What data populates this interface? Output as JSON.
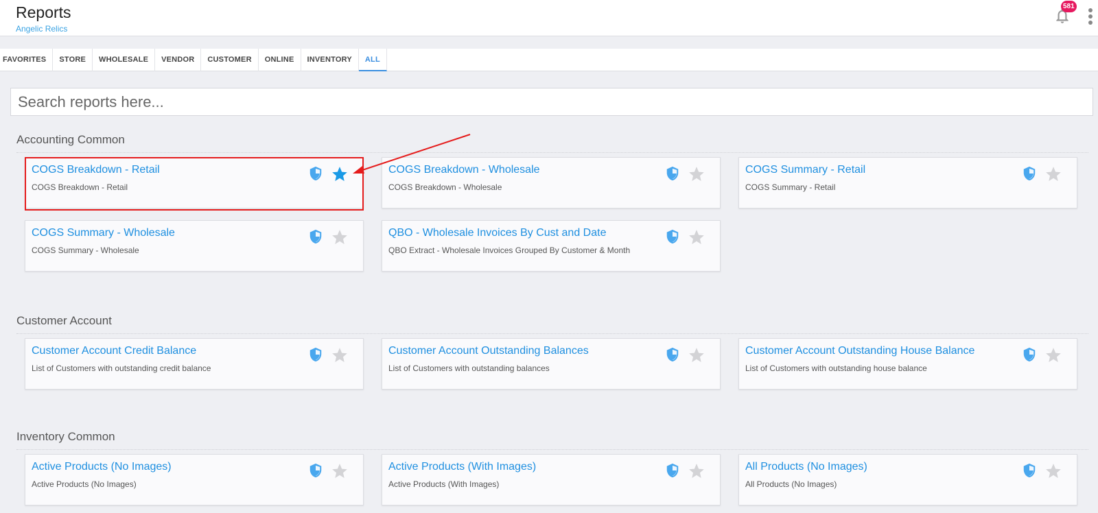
{
  "header": {
    "title": "Reports",
    "subtitle": "Angelic Relics",
    "notification_count": "581"
  },
  "tabs": [
    {
      "label": "FAVORITES",
      "active": false
    },
    {
      "label": "STORE",
      "active": false
    },
    {
      "label": "WHOLESALE",
      "active": false
    },
    {
      "label": "VENDOR",
      "active": false
    },
    {
      "label": "CUSTOMER",
      "active": false
    },
    {
      "label": "ONLINE",
      "active": false
    },
    {
      "label": "INVENTORY",
      "active": false
    },
    {
      "label": "ALL",
      "active": true
    }
  ],
  "search": {
    "placeholder": "Search reports here...",
    "value": ""
  },
  "colors": {
    "accent": "#1e8fe0",
    "star_active": "#1a9ae6",
    "star_inactive": "#d3d3d6",
    "shield": "#49a7ee",
    "badge": "#e6195f",
    "annotation": "#e51c1c"
  },
  "sections": [
    {
      "title": "Accounting Common",
      "reports": [
        {
          "title": "COGS Breakdown - Retail",
          "description": "COGS Breakdown - Retail",
          "favorite": true
        },
        {
          "title": "COGS Breakdown - Wholesale",
          "description": "COGS Breakdown - Wholesale",
          "favorite": false
        },
        {
          "title": "COGS Summary - Retail",
          "description": "COGS Summary - Retail",
          "favorite": false
        },
        {
          "title": "COGS Summary - Wholesale",
          "description": "COGS Summary - Wholesale",
          "favorite": false
        },
        {
          "title": "QBO - Wholesale Invoices By Cust and Date",
          "description": "QBO Extract - Wholesale Invoices Grouped By Customer & Month",
          "favorite": false
        }
      ]
    },
    {
      "title": "Customer Account",
      "reports": [
        {
          "title": "Customer Account Credit Balance",
          "description": "List of Customers with outstanding credit balance",
          "favorite": false
        },
        {
          "title": "Customer Account Outstanding Balances",
          "description": "List of Customers with outstanding balances",
          "favorite": false
        },
        {
          "title": "Customer Account Outstanding House Balance",
          "description": "List of Customers with outstanding house balance",
          "favorite": false
        }
      ]
    },
    {
      "title": "Inventory Common",
      "reports": [
        {
          "title": "Active Products (No Images)",
          "description": "Active Products (No Images)",
          "favorite": false
        },
        {
          "title": "Active Products (With Images)",
          "description": "Active Products (With Images)",
          "favorite": false
        },
        {
          "title": "All Products (No Images)",
          "description": "All Products (No Images)",
          "favorite": false
        }
      ]
    }
  ],
  "icons": {
    "notifications": "bell-icon",
    "menu": "kebab-menu-icon",
    "access": "shield-icon",
    "favorite": "star-icon"
  }
}
